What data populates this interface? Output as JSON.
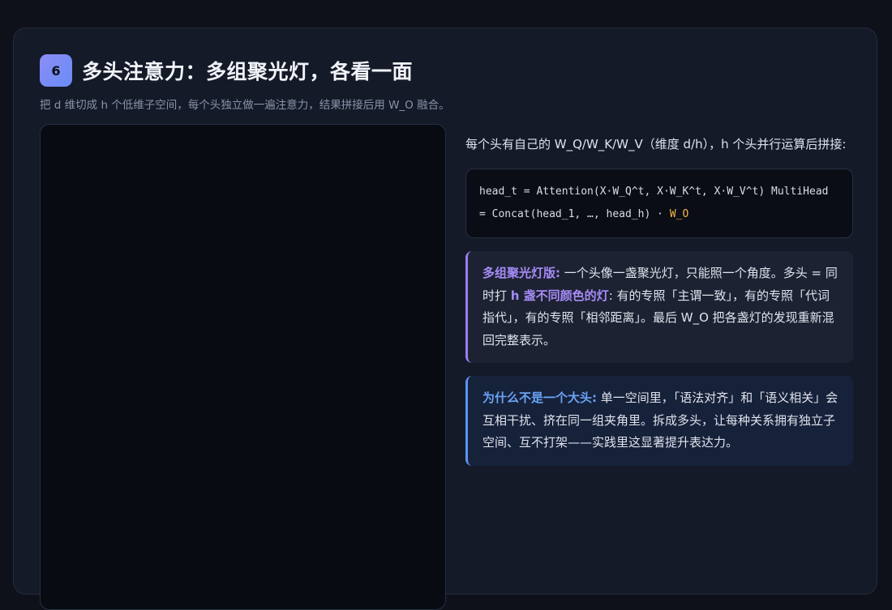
{
  "section": {
    "number": "6",
    "title": "多头注意力：多组聚光灯，各看一面",
    "subtitle": "把 d 维切成 h 个低维子空间，每个头独立做一遍注意力，结果拼接后用 W_O 融合。"
  },
  "intro": "每个头有自己的 W_Q/W_K/W_V（维度 d/h），h 个头并行运算后拼接:",
  "code": {
    "text": "head_t = Attention(X·W_Q^t, X·W_K^t, X·W_V^t) MultiHead = Concat(head_1, …, head_h) · ",
    "highlight": "W_O"
  },
  "analogy": {
    "label": "多组聚光灯版:",
    "text_1": " 一个头像一盏聚光灯，只能照一个角度。多头 = 同时打 ",
    "emphasis": "h 盏不同颜色的灯",
    "text_2": ": 有的专照「主谓一致」，有的专照「代词指代」，有的专照「相邻距离」。最后 W_O 把各盏灯的发现重新混回完整表示。"
  },
  "why": {
    "label": "为什么不是一个大头:",
    "text": " 单一空间里，「语法对齐」和「语义相关」会互相干扰、挤在同一组夹角里。拆成多头，让每种关系拥有独立子空间、互不打架——实践里这显著提升表达力。"
  },
  "colors": {
    "accent_purple": "#9b7cf3",
    "accent_blue": "#5b93ee",
    "code_highlight": "#f5b84a"
  }
}
